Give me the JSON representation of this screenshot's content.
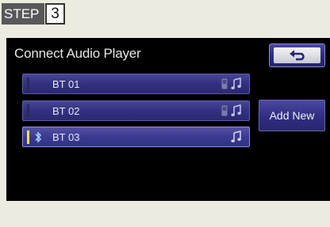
{
  "step": {
    "word": "STEP",
    "number": "3"
  },
  "screen": {
    "title": "Connect Audio Player",
    "add_new_label": "Add New",
    "devices": [
      {
        "name": "BT 01",
        "selected": false,
        "bluetooth_connected": false,
        "icons": [
          "phone-icon",
          "music-icon"
        ]
      },
      {
        "name": "BT 02",
        "selected": false,
        "bluetooth_connected": false,
        "icons": [
          "phone-icon",
          "music-icon"
        ]
      },
      {
        "name": "BT 03",
        "selected": true,
        "bluetooth_connected": true,
        "icons": [
          "music-icon"
        ]
      }
    ]
  },
  "colors": {
    "button_blue": "#323180",
    "connected_indicator": "#e9e25a",
    "screen_background": "#000000"
  }
}
